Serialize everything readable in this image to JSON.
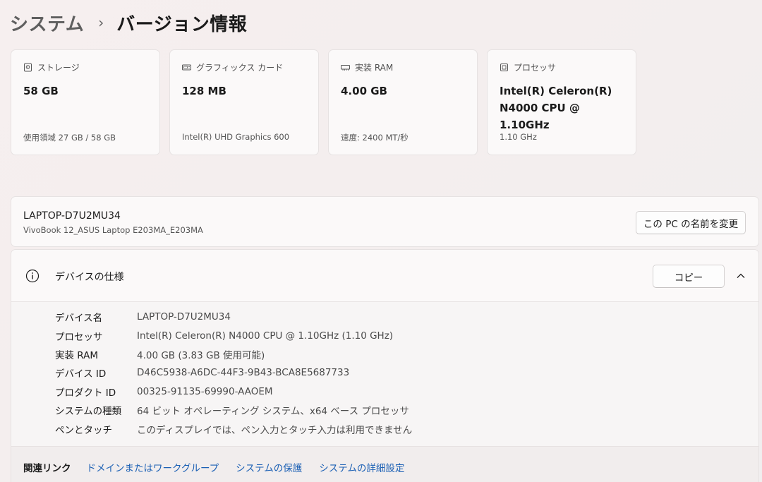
{
  "breadcrumb": {
    "parent": "システム",
    "separator": "›",
    "current": "バージョン情報"
  },
  "cards": [
    {
      "label": "ストレージ",
      "value": "58 GB",
      "sub": "使用領域 27 GB / 58 GB",
      "icon": "storage-icon"
    },
    {
      "label": "グラフィックス カード",
      "value": "128 MB",
      "sub": "Intel(R) UHD Graphics 600",
      "icon": "graphics-card-icon"
    },
    {
      "label": "実装 RAM",
      "value": "4.00 GB",
      "sub": "速度: 2400 MT/秒",
      "icon": "ram-icon"
    },
    {
      "label": "プロセッサ",
      "value_line1": "Intel(R) Celeron(R)",
      "value_line2": "N4000 CPU @ 1.10GHz",
      "sub": "1.10 GHz",
      "icon": "processor-icon"
    }
  ],
  "device": {
    "name": "LAPTOP-D7U2MU34",
    "model": "VivoBook 12_ASUS Laptop E203MA_E203MA",
    "rename_label": "この PC の名前を変更"
  },
  "spec": {
    "title": "デバイスの仕様",
    "copy_label": "コピー",
    "rows": [
      {
        "key": "デバイス名",
        "value": "LAPTOP-D7U2MU34"
      },
      {
        "key": "プロセッサ",
        "value": "Intel(R) Celeron(R) N4000 CPU @ 1.10GHz (1.10 GHz)"
      },
      {
        "key": "実装 RAM",
        "value": "4.00 GB (3.83 GB 使用可能)"
      },
      {
        "key": "デバイス ID",
        "value": "D46C5938-A6DC-44F3-9B43-BCA8E5687733"
      },
      {
        "key": "プロダクト ID",
        "value": "00325-91135-69990-AAOEM"
      },
      {
        "key": "システムの種類",
        "value": "64 ビット オペレーティング システム、x64 ベース プロセッサ"
      },
      {
        "key": "ペンとタッチ",
        "value": "このディスプレイでは、ペン入力とタッチ入力は利用できません"
      }
    ]
  },
  "related": {
    "title": "関連リンク",
    "links": [
      "ドメインまたはワークグループ",
      "システムの保護",
      "システムの詳細設定"
    ]
  },
  "colors": {
    "link": "#1a5fb4",
    "card_bg": "#fbf9f9",
    "border": "#e6e2e2"
  }
}
